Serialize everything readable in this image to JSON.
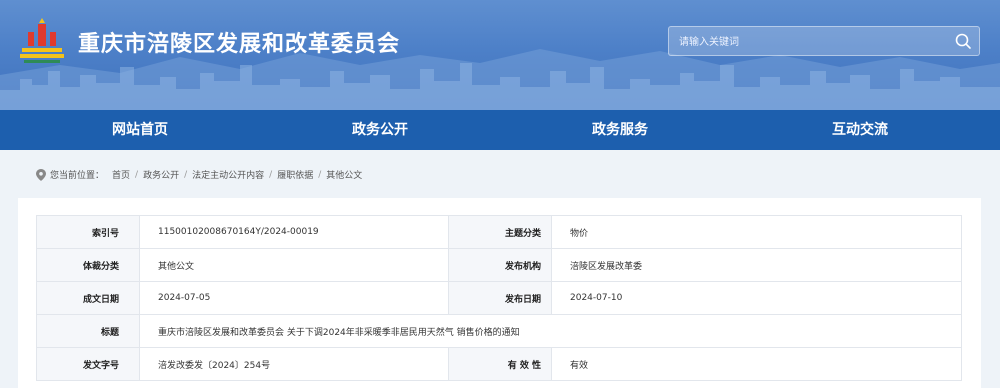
{
  "header": {
    "site_title": "重庆市涪陵区发展和改革委员会",
    "search_placeholder": "请输入关键词"
  },
  "nav": {
    "items": [
      {
        "label": "网站首页"
      },
      {
        "label": "政务公开"
      },
      {
        "label": "政务服务"
      },
      {
        "label": "互动交流"
      }
    ]
  },
  "breadcrumb": {
    "prefix": "您当前位置：",
    "items": [
      "首页",
      "政务公开",
      "法定主动公开内容",
      "履职依据",
      "其他公文"
    ]
  },
  "info": {
    "index_label": "索引号",
    "index_value": "11500102008670164Y/2024-00019",
    "topic_label": "主题分类",
    "topic_value": "物价",
    "genre_label": "体裁分类",
    "genre_value": "其他公文",
    "org_label": "发布机构",
    "org_value": "涪陵区发展改革委",
    "written_label": "成文日期",
    "written_value": "2024-07-05",
    "pub_label": "发布日期",
    "pub_value": "2024-07-10",
    "title_label": "标题",
    "title_value": "重庆市涪陵区发展和改革委员会 关于下调2024年非采暖季非居民用天然气 销售价格的通知",
    "docno_label": "发文字号",
    "docno_value": "涪发改委发〔2024〕254号",
    "valid_label": "有 效 性",
    "valid_value": "有效"
  },
  "colors": {
    "nav_bg": "#1d5fae",
    "header_bg": "#4d80c8",
    "page_bg": "#eef3f8"
  }
}
